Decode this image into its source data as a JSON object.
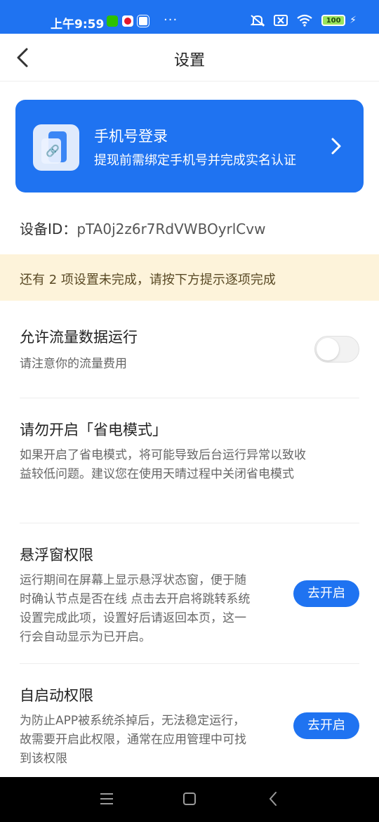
{
  "status_bar": {
    "time": "上午9:59",
    "more": "···",
    "battery": "100",
    "icons": [
      "wechat-icon",
      "weibo-icon",
      "message-icon",
      "mute-icon",
      "sim-off-icon",
      "wifi-icon",
      "battery-icon",
      "charging-icon"
    ]
  },
  "nav": {
    "title": "设置"
  },
  "login_card": {
    "title": "手机号登录",
    "subtitle": "提现前需绑定手机号并完成实名认证"
  },
  "device": {
    "label": "设备ID：",
    "value": "pTA0j2z6r7RdVWBOyrlCvw"
  },
  "notice": {
    "text": "还有 2 项设置未完成，请按下方提示逐项完成"
  },
  "settings": {
    "data_usage": {
      "title": "允许流量数据运行",
      "desc": "请注意你的流量费用",
      "enabled": false
    },
    "power_saving": {
      "title": "请勿开启「省电模式」",
      "desc_line1": "如果开启了省电模式，将可能导致后台运行异常以致收",
      "desc_line2": "益较低问题。建议您在使用天晴过程中关闭省电模式"
    },
    "floating_window": {
      "title": "悬浮窗权限",
      "desc_line1": "运行期间在屏幕上显示悬浮状态窗，便于随",
      "desc_line2": "时确认节点是否在线 点击去开启将跳转系统",
      "desc_line3": "设置完成此项，设置好后请返回本页，这一",
      "desc_line4": "行会自动显示为已开启。",
      "button": "去开启"
    },
    "autostart": {
      "title": "自启动权限",
      "desc_line1": "为防止APP被系统杀掉后，无法稳定运行，",
      "desc_line2": "故需要开启此权限，通常在应用管理中可找",
      "desc_line3": "到该权限",
      "button": "去开启"
    }
  },
  "colors": {
    "primary": "#1f73f1",
    "notice_bg": "#fdf3da"
  }
}
